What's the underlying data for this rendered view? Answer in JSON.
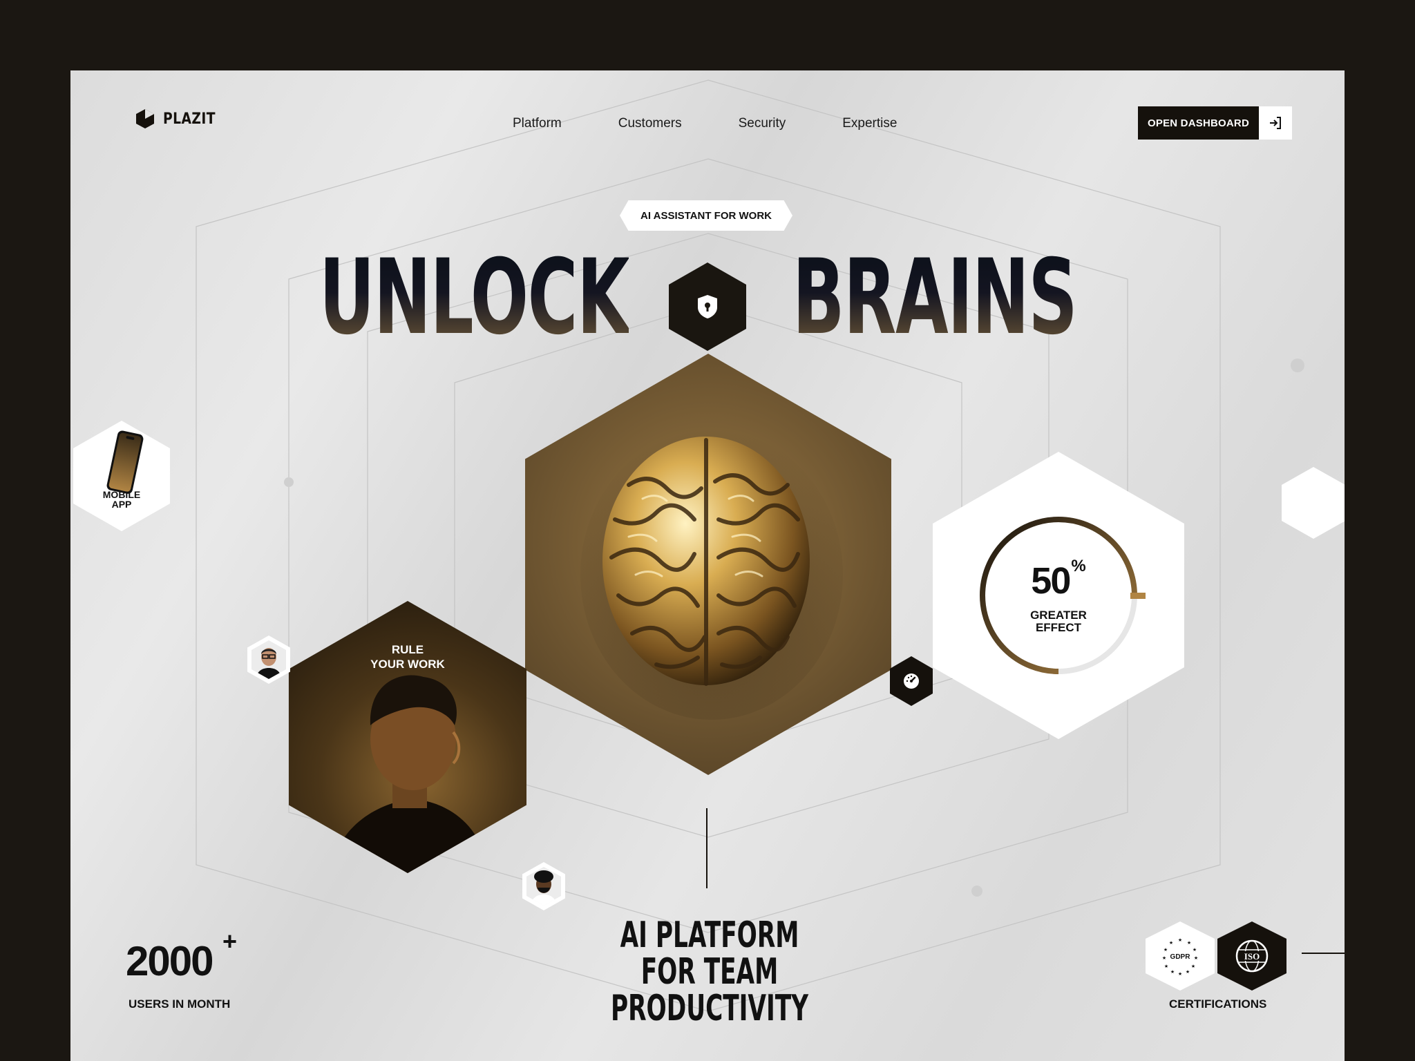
{
  "brand": {
    "name": "PLAZIT"
  },
  "nav": {
    "items": [
      "Platform",
      "Customers",
      "Security",
      "Expertise"
    ]
  },
  "cta": {
    "label": "OPEN DASHBOARD",
    "icon": "login-icon"
  },
  "hero": {
    "badge": "AI ASSISTANT FOR WORK",
    "headline_left": "UNLOCK",
    "headline_right": "BRAINS",
    "center_icon": "lock-icon",
    "main_image": "gold-brain-image"
  },
  "mobile_card": {
    "label_line1": "MOBILE",
    "label_line2": "APP"
  },
  "work_card": {
    "title_line1": "RULE",
    "title_line2": "YOUR WORK"
  },
  "stat": {
    "value": "50",
    "unit": "%",
    "label_line1": "GREATER",
    "label_line2": "EFFECT",
    "progress": 0.75
  },
  "users": {
    "value": "2000",
    "suffix": "+",
    "label": "USERS IN MONTH"
  },
  "tagline": {
    "line1": "AI PLATFORM",
    "line2": "FOR TEAM",
    "line3": "PRODUCTIVITY"
  },
  "certifications": {
    "label": "CERTIFICATIONS",
    "gdpr": "GDPR",
    "iso": "ISO"
  },
  "colors": {
    "dark": "#15110c",
    "gold": "#b08443",
    "page_bg": "#e2e2e2",
    "frame": "#1b1712"
  }
}
